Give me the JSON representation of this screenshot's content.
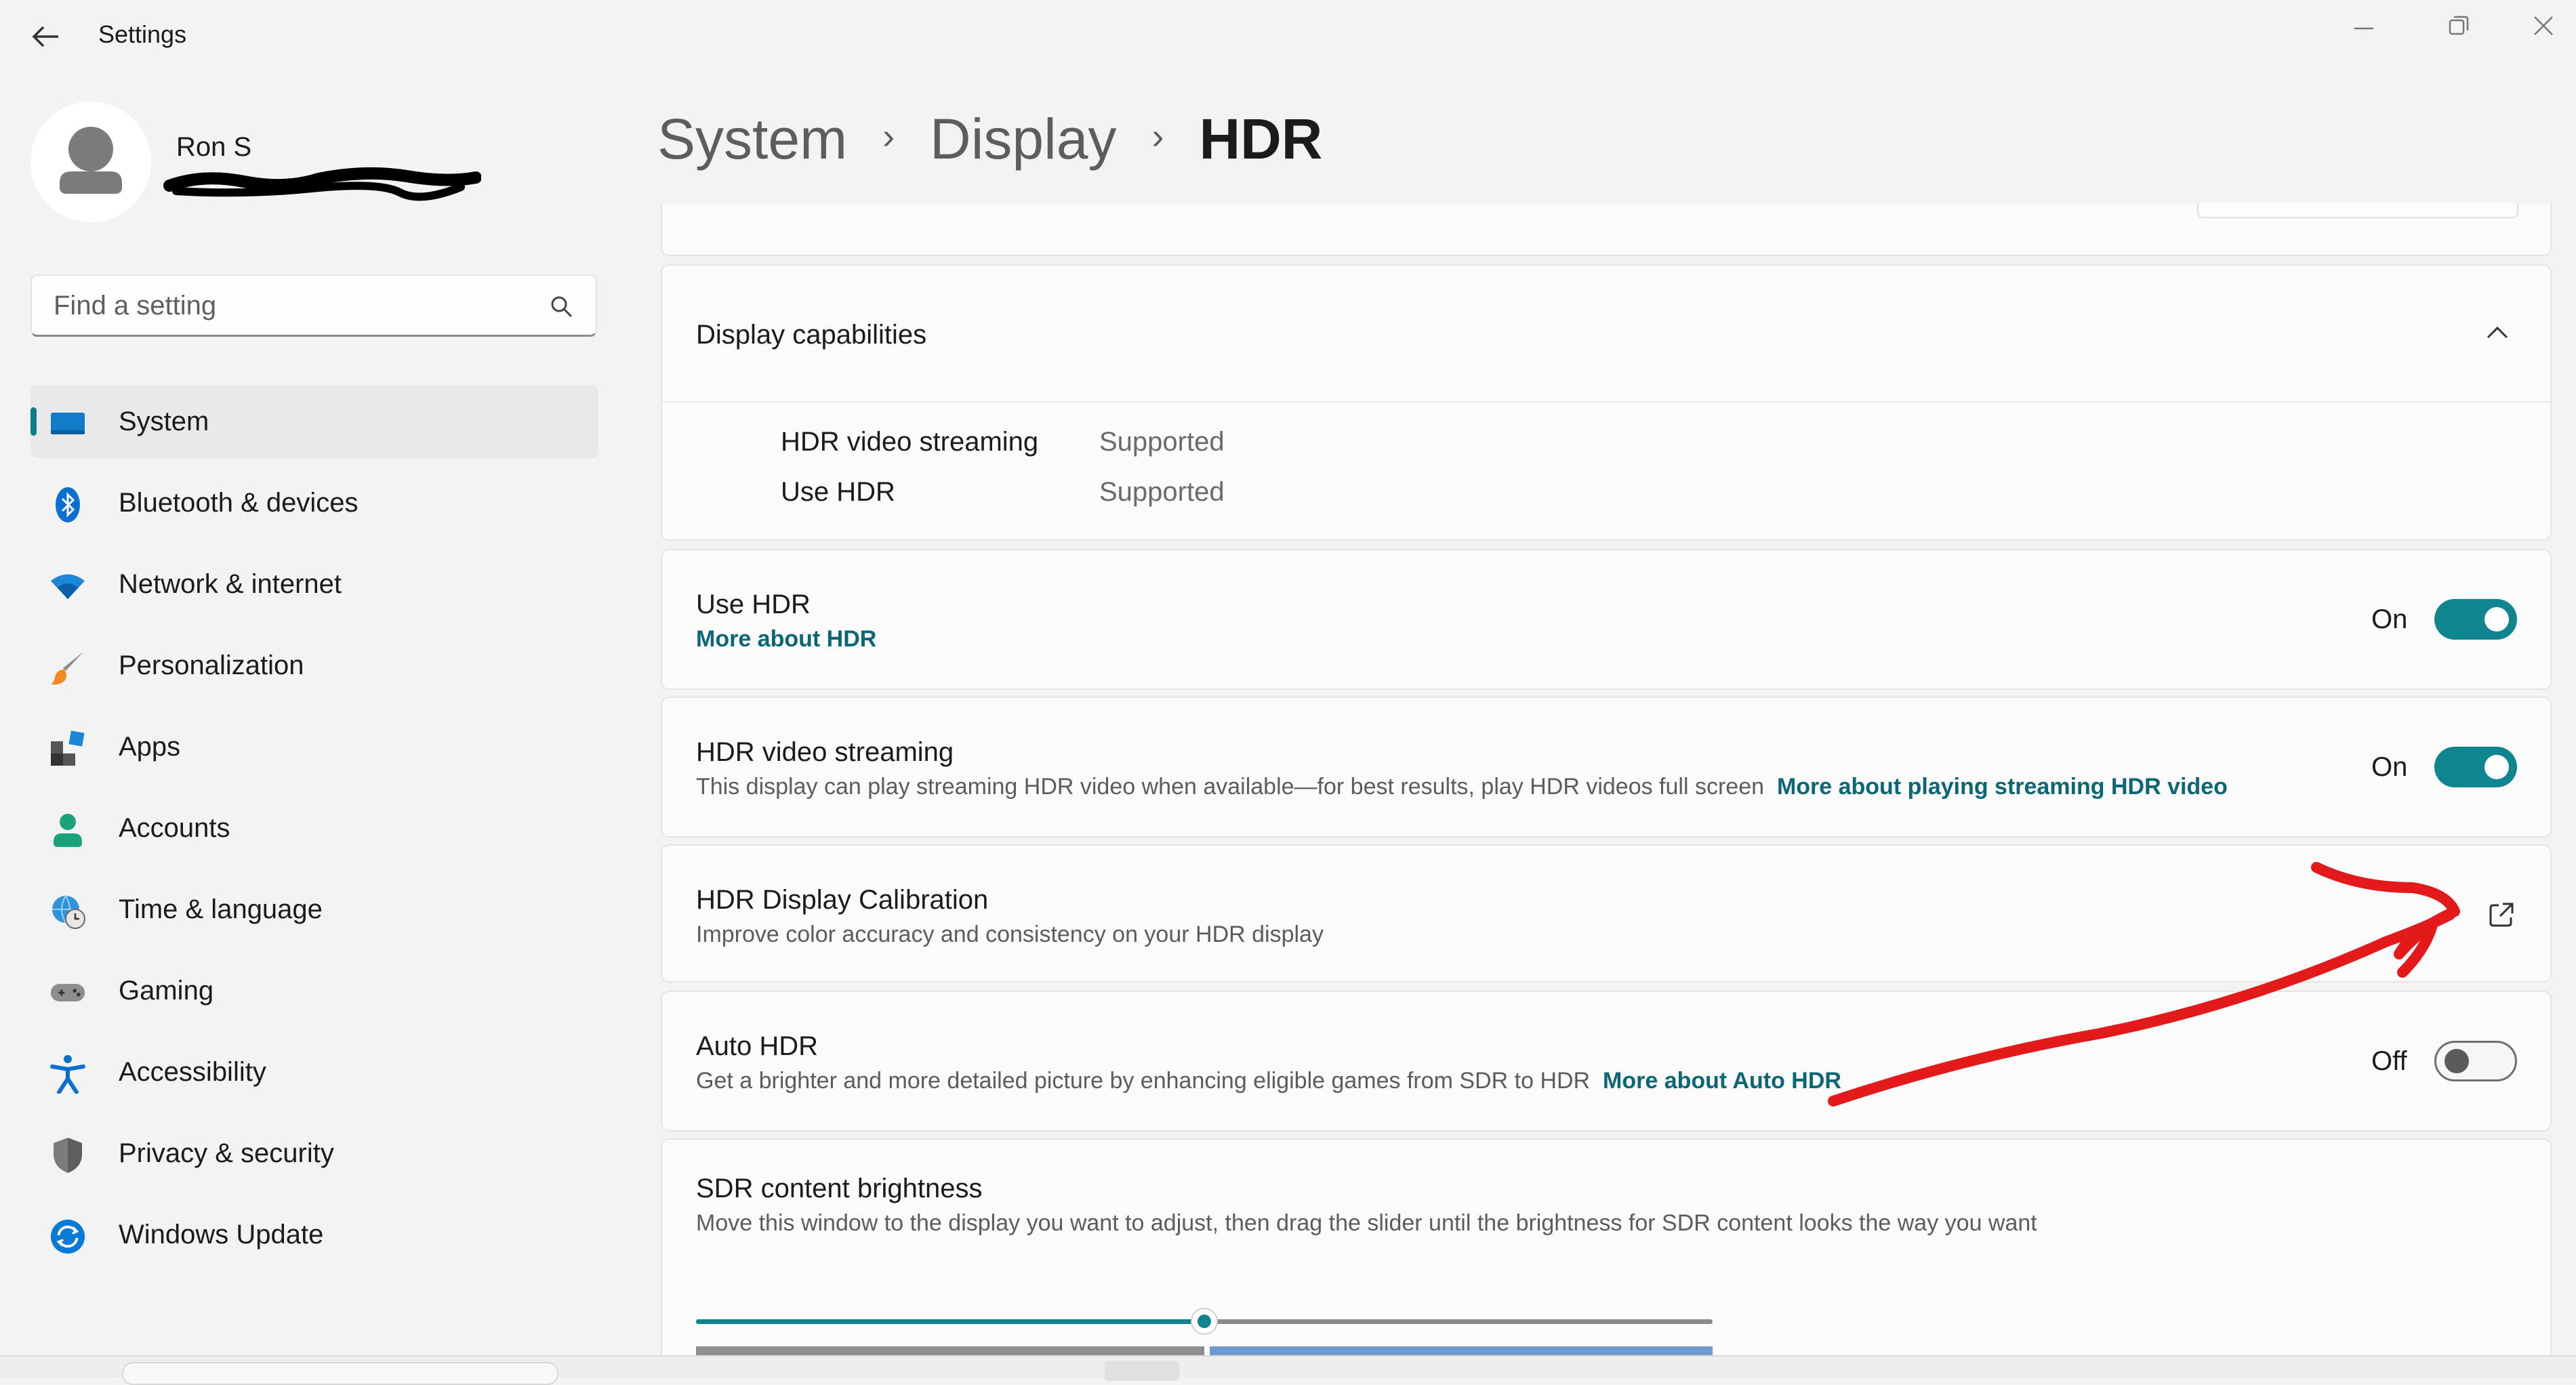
{
  "window": {
    "title": "Settings",
    "back_icon": "back-arrow-icon",
    "controls": [
      "minimize-icon",
      "restore-icon",
      "close-icon"
    ]
  },
  "profile": {
    "name": "Ron S",
    "email_redacted": true
  },
  "search": {
    "placeholder": "Find a setting",
    "icon": "search-icon"
  },
  "sidebar": {
    "items": [
      {
        "label": "System",
        "icon": "system-icon",
        "selected": true
      },
      {
        "label": "Bluetooth & devices",
        "icon": "bluetooth-icon"
      },
      {
        "label": "Network & internet",
        "icon": "wifi-icon"
      },
      {
        "label": "Personalization",
        "icon": "brush-icon"
      },
      {
        "label": "Apps",
        "icon": "apps-icon"
      },
      {
        "label": "Accounts",
        "icon": "account-icon"
      },
      {
        "label": "Time & language",
        "icon": "globe-clock-icon"
      },
      {
        "label": "Gaming",
        "icon": "gamepad-icon"
      },
      {
        "label": "Accessibility",
        "icon": "accessibility-icon"
      },
      {
        "label": "Privacy & security",
        "icon": "shield-icon"
      },
      {
        "label": "Windows Update",
        "icon": "update-icon"
      }
    ]
  },
  "breadcrumb": {
    "items": [
      "System",
      "Display",
      "HDR"
    ],
    "separator": "›"
  },
  "capabilities": {
    "title": "Display capabilities",
    "expanded": true,
    "rows": [
      {
        "name": "HDR video streaming",
        "value": "Supported"
      },
      {
        "name": "Use HDR",
        "value": "Supported"
      }
    ]
  },
  "use_hdr": {
    "title": "Use HDR",
    "link": "More about HDR",
    "state": "On",
    "on": true
  },
  "hdr_video": {
    "title": "HDR video streaming",
    "desc": "This display can play streaming HDR video when available—for best results, play HDR videos full screen",
    "link": "More about playing streaming HDR video",
    "state": "On",
    "on": true
  },
  "calibration": {
    "title": "HDR Display Calibration",
    "desc": "Improve color accuracy and consistency on your HDR display",
    "icon": "open-external-icon"
  },
  "auto_hdr": {
    "title": "Auto HDR",
    "desc": "Get a brighter and more detailed picture by enhancing eligible games from SDR to HDR",
    "link": "More about Auto HDR",
    "state": "Off",
    "on": false
  },
  "sdr": {
    "title": "SDR content brightness",
    "desc": "Move this window to the display you want to adjust, then drag the slider until the brightness for SDR content looks the way you want",
    "level": 0.5
  },
  "annotation": {
    "color": "#e3191a"
  },
  "colors": {
    "accent": "#0f8590",
    "link": "#0b6775"
  }
}
